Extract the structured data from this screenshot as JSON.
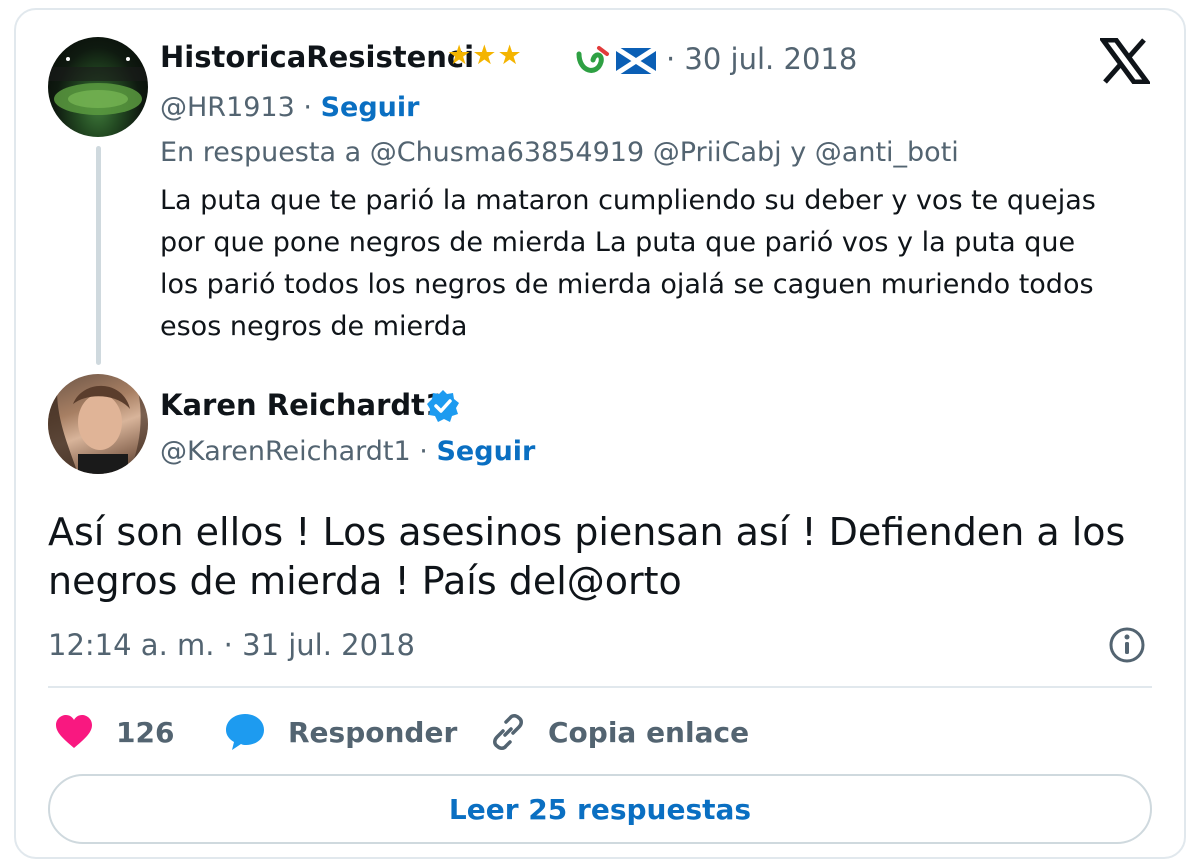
{
  "parent_tweet": {
    "display_name": "HistoricaResistenci",
    "name_emoji": [
      "star",
      "star",
      "star",
      "green-hook",
      "saltire-flag"
    ],
    "date": "· 30 jul. 2018",
    "handle": "@HR1913",
    "separator": "·",
    "follow_label": "Seguir",
    "reply_to": "En respuesta a @Chusma63854919 @PriiCabj y @anti_boti",
    "text_lines": [
      "La puta que te parió la mataron cumpliendo su deber y vos te quejas",
      "por que pone negros de mierda La puta que parió vos y la puta que",
      "los parió todos los negros de mierda ojalá se caguen muriendo todos",
      "esos negros de mierda"
    ]
  },
  "main_tweet": {
    "display_name": "Karen Reichardt1",
    "verified": true,
    "handle": "@KarenReichardt1",
    "separator": "·",
    "follow_label": "Seguir",
    "text_lines": [
      "Así son ellos ! Los asesinos piensan así ! Defienden a los",
      "negros de mierda ! País del@orto"
    ],
    "timestamp": "12:14 a. m. · 31 jul. 2018"
  },
  "actions": {
    "like_count": "126",
    "reply_label": "Responder",
    "copy_link_label": "Copia enlace"
  },
  "read_replies_label": "Leer 25 respuestas",
  "icons": {
    "brand": "x-logo-icon",
    "verified": "verified-badge-icon",
    "info": "info-icon",
    "like": "heart-icon",
    "reply": "speech-bubble-icon",
    "link": "link-icon"
  },
  "colors": {
    "link_blue": "#0a6fc2",
    "verified_blue": "#1d9bf0",
    "like_pink": "#f91880",
    "muted_text": "#536471",
    "border": "#e1e8ed"
  }
}
